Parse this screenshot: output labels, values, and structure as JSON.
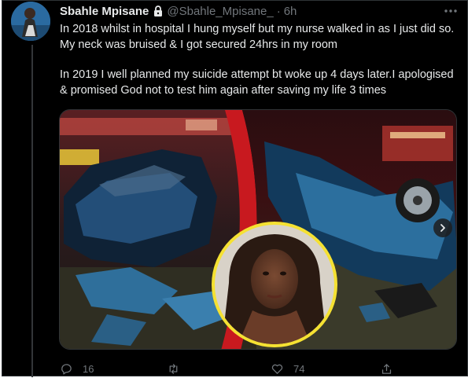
{
  "tweet": {
    "display_name": "Sbahle Mpisane",
    "handle": "@Sbahle_Mpisane_",
    "separator": "·",
    "time": "6h",
    "paragraphs": [
      "In 2018 whilst in hospital I hung myself but my nurse walked in as I just did so. My neck was bruised & I got secured 24hrs in my room",
      "In 2019 I well planned my suicide attempt bt woke up 4 days later.I apologised & promised God not to test him again after saving my life 3 times"
    ]
  },
  "icons": {
    "protected": "lock-icon",
    "more": "more-icon",
    "next": "chevron-right-icon",
    "reply": "reply-icon",
    "retweet": "retweet-icon",
    "like": "heart-icon",
    "share": "share-icon"
  },
  "actions": {
    "reply_count": "16",
    "retweet_count": "",
    "like_count": "74"
  },
  "colors": {
    "background": "#000000",
    "text": "#e7e9ea",
    "muted": "#71767b",
    "divider": "#2f3336",
    "portrait_ring": "#f5e132"
  }
}
